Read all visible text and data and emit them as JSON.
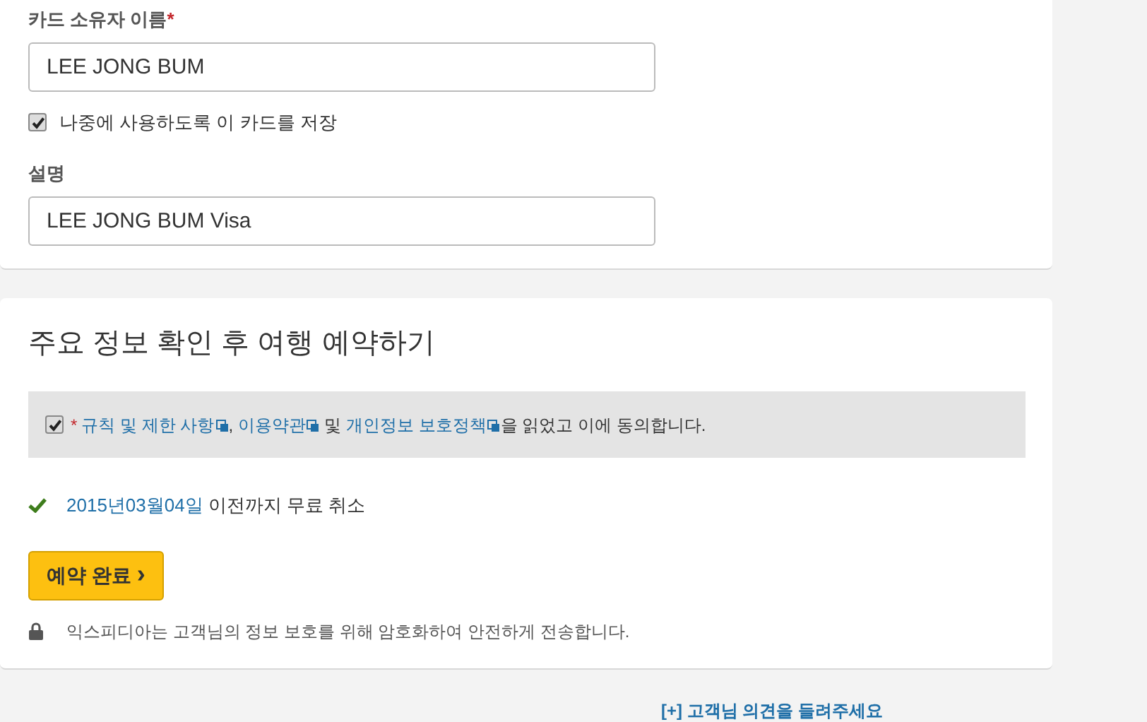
{
  "card_form": {
    "fields": [
      {
        "label": "카드 소유자 이름",
        "required": true,
        "value": "LEE JONG BUM"
      },
      {
        "kind": "checkbox",
        "label": "나중에 사용하도록 이 카드를 저장",
        "checked": true
      },
      {
        "label": "설명",
        "required": false,
        "value": "LEE JONG BUM Visa"
      }
    ]
  },
  "booking": {
    "title": "주요 정보 확인 후 여행 예약하기",
    "agreement": {
      "checked": true,
      "required_mark": "*",
      "links": [
        {
          "text": "규칙 및 제한 사항",
          "after": ", "
        },
        {
          "text": "이용약관",
          "after": " 및 "
        },
        {
          "text": "개인정보 보호정책",
          "after": "을 읽었고 이에 동의합니다."
        }
      ]
    },
    "cancellation": {
      "date": "2015년03월04일",
      "text": " 이전까지 무료 취소"
    },
    "submit_button": {
      "label": "예약 완료",
      "icon": "›"
    },
    "security_note": "익스피디아는 고객님의 정보 보호를 위해 암호화하여 안전하게 전송합니다."
  },
  "feedback_link": "[+] 고객님 의견을 들려주세요"
}
